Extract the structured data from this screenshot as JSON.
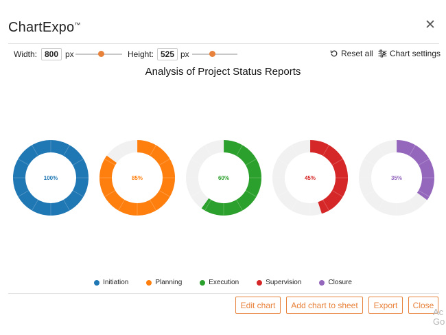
{
  "dialog": {
    "title": "ChartExpo",
    "trademark": "™",
    "close_icon": "close-icon"
  },
  "controls": {
    "width_label": "Width:",
    "width_value": "800",
    "width_unit": "px",
    "width_slider_level": 0.55,
    "height_label": "Height:",
    "height_value": "525",
    "height_unit": "px",
    "height_slider_level": 0.45,
    "reset_label": "Reset all",
    "settings_label": "Chart settings"
  },
  "chart_data": {
    "type": "donut",
    "title": "Analysis of Project Status Reports",
    "track_color": "#f1f1f1",
    "series": [
      {
        "name": "Initiation",
        "value": 100,
        "label": "100%",
        "color": "#1f77b4"
      },
      {
        "name": "Planning",
        "value": 85,
        "label": "85%",
        "color": "#ff7f0e"
      },
      {
        "name": "Execution",
        "value": 60,
        "label": "60%",
        "color": "#2ca02c"
      },
      {
        "name": "Supervision",
        "value": 45,
        "label": "45%",
        "color": "#d62728"
      },
      {
        "name": "Closure",
        "value": 35,
        "label": "35%",
        "color": "#9467bd"
      }
    ]
  },
  "footer": {
    "edit_label": "Edit chart",
    "add_label": "Add chart to sheet",
    "export_label": "Export",
    "close_label": "Close"
  },
  "watermark": {
    "line1": "Ac",
    "line2": "Go"
  }
}
